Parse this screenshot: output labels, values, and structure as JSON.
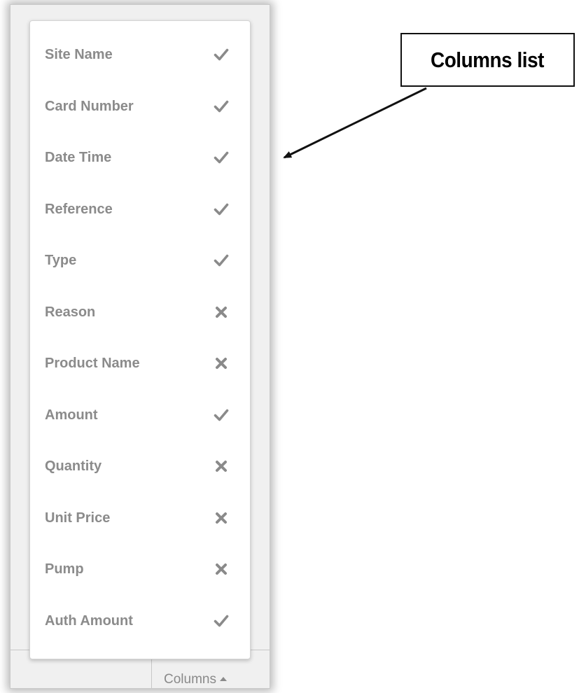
{
  "columns_menu": {
    "items": [
      {
        "label": "Site Name",
        "visible": true,
        "icon": "check-icon"
      },
      {
        "label": "Card Number",
        "visible": true,
        "icon": "check-icon"
      },
      {
        "label": "Date Time",
        "visible": true,
        "icon": "check-icon"
      },
      {
        "label": "Reference",
        "visible": true,
        "icon": "check-icon"
      },
      {
        "label": "Type",
        "visible": true,
        "icon": "check-icon"
      },
      {
        "label": "Reason",
        "visible": false,
        "icon": "cross-icon"
      },
      {
        "label": "Product Name",
        "visible": false,
        "icon": "cross-icon"
      },
      {
        "label": "Amount",
        "visible": true,
        "icon": "check-icon"
      },
      {
        "label": "Quantity",
        "visible": false,
        "icon": "cross-icon"
      },
      {
        "label": "Unit Price",
        "visible": false,
        "icon": "cross-icon"
      },
      {
        "label": "Pump",
        "visible": false,
        "icon": "cross-icon"
      },
      {
        "label": "Auth Amount",
        "visible": true,
        "icon": "check-icon"
      }
    ]
  },
  "footer": {
    "columns_button_label": "Columns",
    "caret_icon": "caret-up-icon"
  },
  "callout": {
    "text": "Columns list"
  },
  "colors": {
    "label": "#8b8b8b",
    "icon": "#8a8a8a",
    "callout_border": "#111111"
  }
}
